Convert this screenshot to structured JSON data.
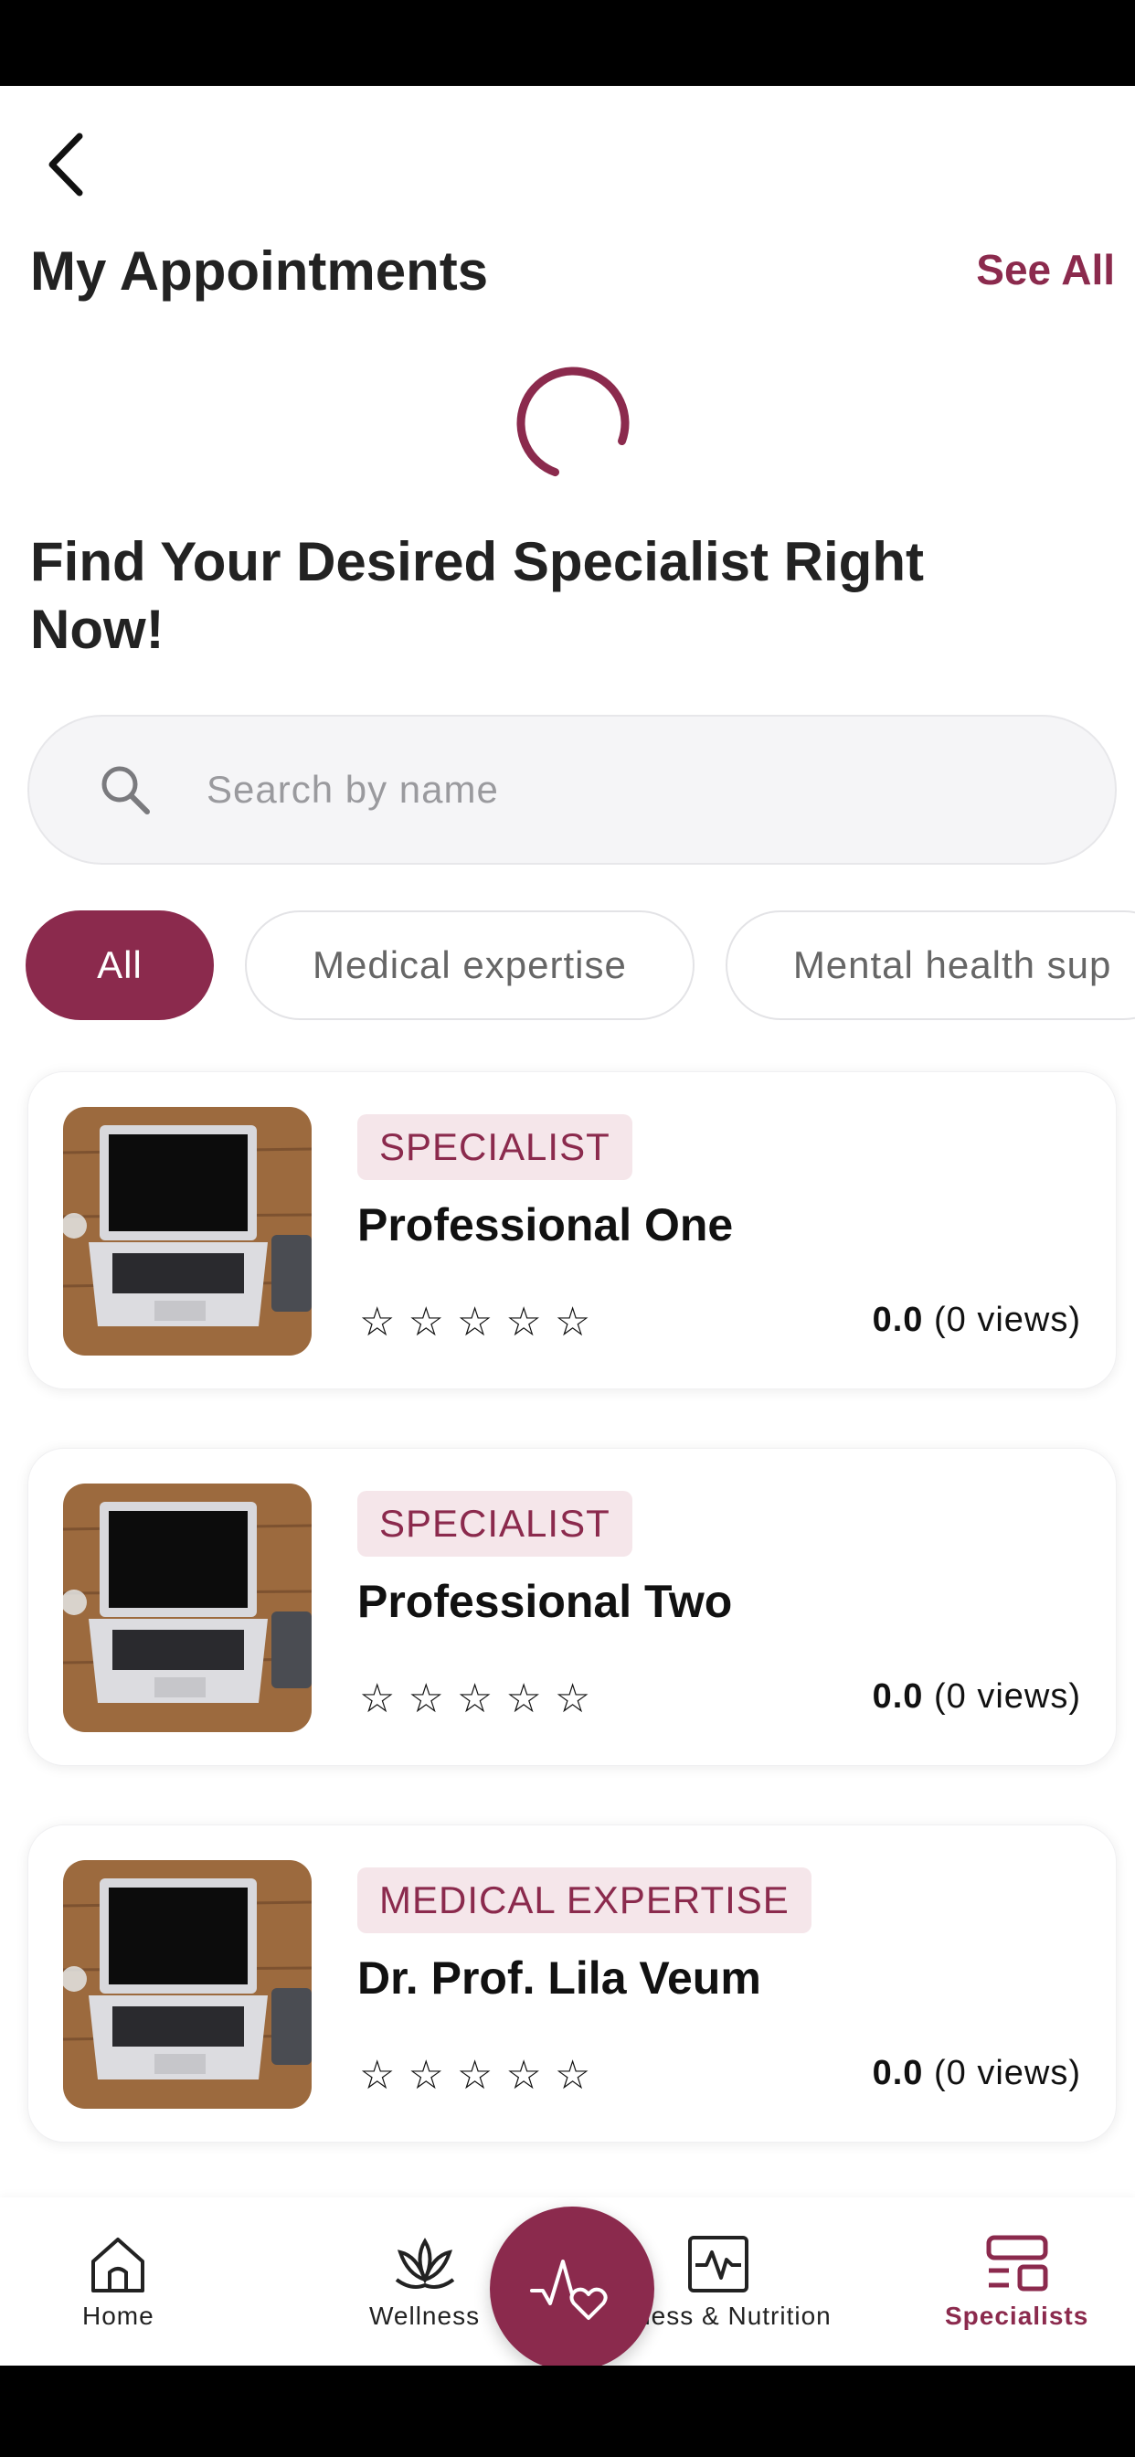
{
  "header": {
    "back_icon": "chevron-left-icon"
  },
  "appointments": {
    "title": "My Appointments",
    "see_all_label": "See All",
    "loading": true
  },
  "finder": {
    "headline": "Find Your Desired Specialist Right Now!"
  },
  "search": {
    "placeholder": "Search by name",
    "value": "",
    "icon": "search-icon"
  },
  "filters": [
    {
      "label": "All",
      "active": true
    },
    {
      "label": "Medical expertise",
      "active": false
    },
    {
      "label": "Mental health sup",
      "active": false
    }
  ],
  "specialists": [
    {
      "category": "SPECIALIST",
      "name": "Professional One",
      "stars": 0,
      "rating": "0.0",
      "views": "(0 views)"
    },
    {
      "category": "SPECIALIST",
      "name": "Professional Two",
      "stars": 0,
      "rating": "0.0",
      "views": "(0 views)"
    },
    {
      "category": "MEDICAL EXPERTISE",
      "name": "Dr. Prof. Lila Veum",
      "stars": 0,
      "rating": "0.0",
      "views": "(0 views)"
    }
  ],
  "nav": {
    "items": [
      {
        "label": "Home",
        "icon": "home-icon",
        "active": false
      },
      {
        "label": "Wellness",
        "icon": "lotus-icon",
        "active": false
      },
      {
        "label": "Fitness & Nutrition",
        "icon": "pulse-icon",
        "active": false
      },
      {
        "label": "Specialists",
        "icon": "specialists-icon",
        "active": true
      }
    ],
    "fab_icon": "heart-pulse-icon"
  },
  "colors": {
    "accent": "#8b2a4d",
    "badge_bg": "#f5e6ea",
    "search_bg": "#f5f5f7"
  }
}
